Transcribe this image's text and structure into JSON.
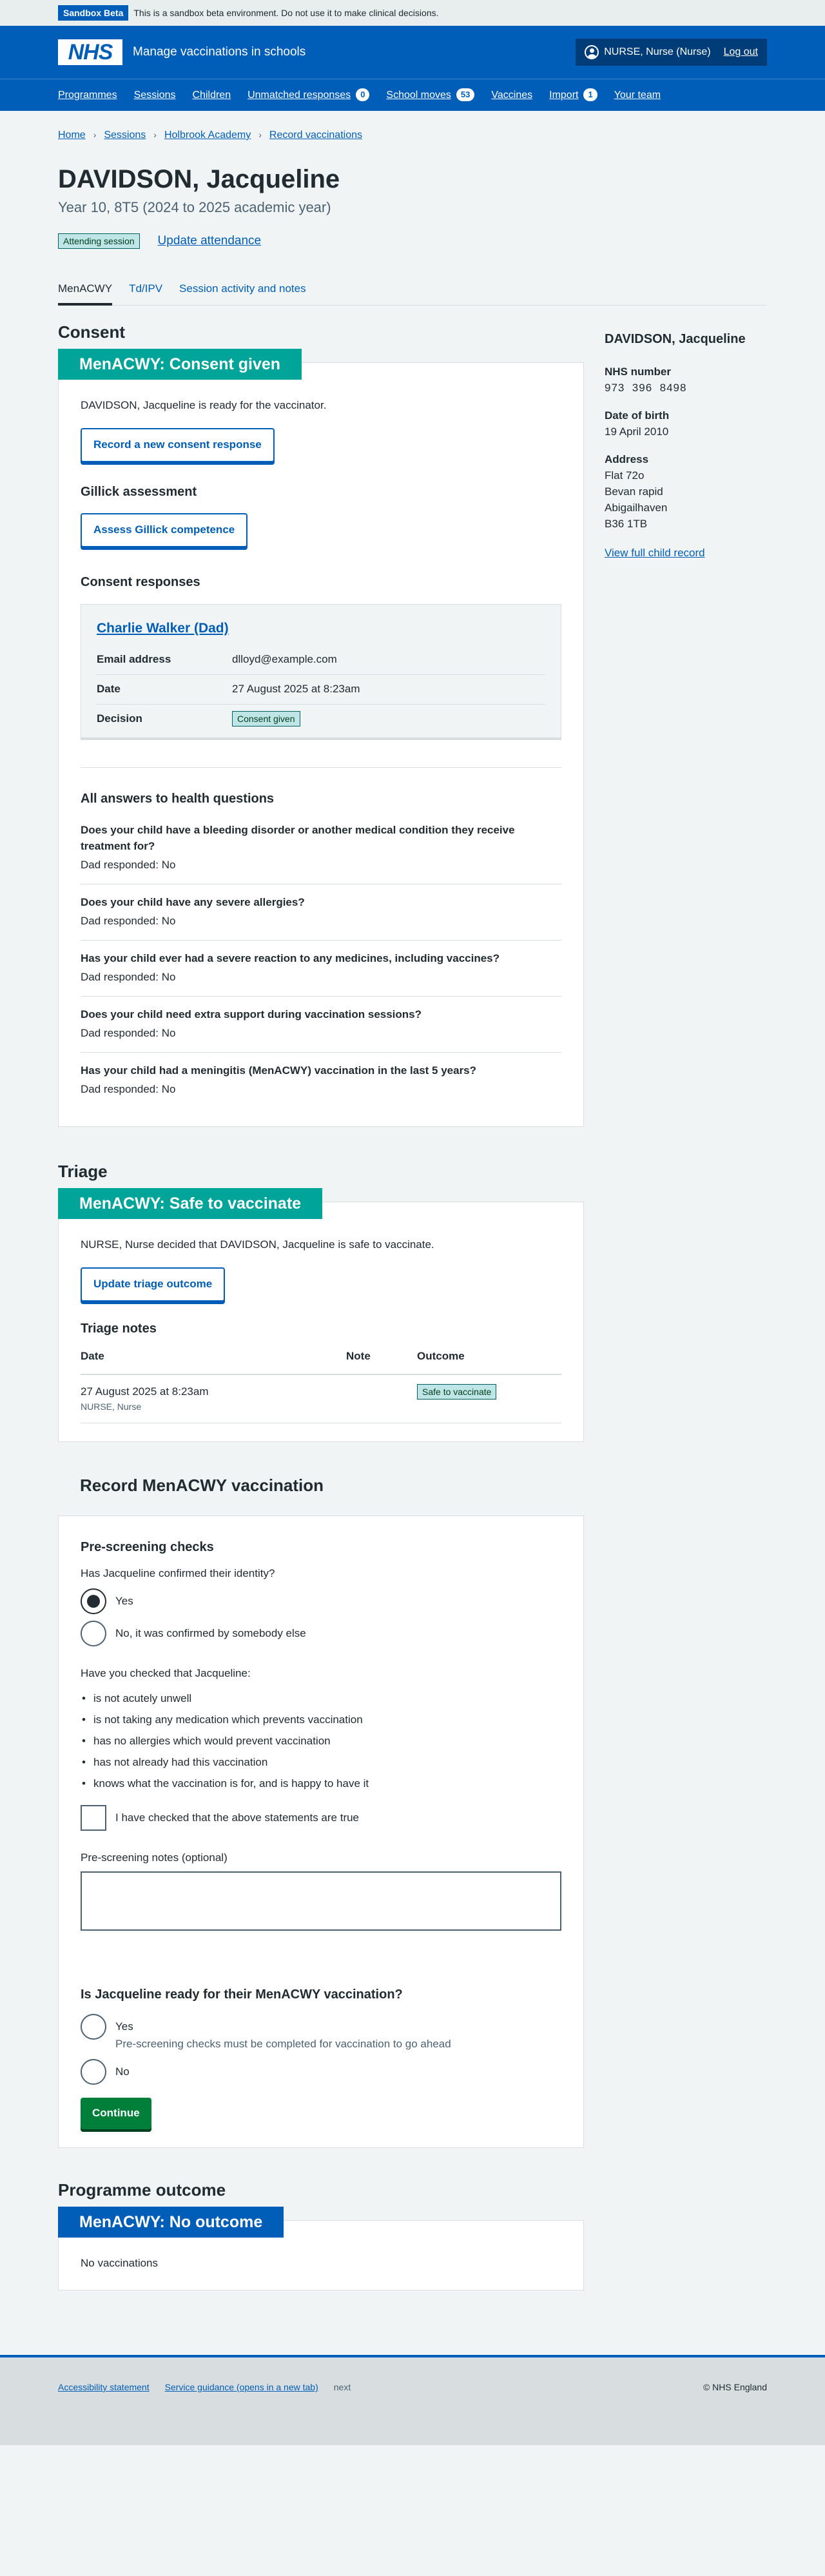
{
  "beta": {
    "tag": "Sandbox Beta",
    "text": "This is a sandbox beta environment. Do not use it to make clinical decisions."
  },
  "header": {
    "logo": "NHS",
    "service": "Manage vaccinations in schools",
    "user": "NURSE, Nurse (Nurse)",
    "logout": "Log out"
  },
  "nav": [
    {
      "label": "Programmes"
    },
    {
      "label": "Sessions"
    },
    {
      "label": "Children"
    },
    {
      "label": "Unmatched responses",
      "count": "0"
    },
    {
      "label": "School moves",
      "count": "53"
    },
    {
      "label": "Vaccines"
    },
    {
      "label": "Import",
      "count": "1"
    },
    {
      "label": "Your team"
    }
  ],
  "breadcrumb": [
    "Home",
    "Sessions",
    "Holbrook Academy",
    "Record vaccinations"
  ],
  "patient": {
    "name": "DAVIDSON, Jacqueline",
    "subtitle": "Year 10, 8T5 (2024 to 2025 academic year)",
    "attending_tag": "Attending session",
    "update_attendance": "Update attendance"
  },
  "tabs": [
    "MenACWY",
    "Td/IPV",
    "Session activity and notes"
  ],
  "consent": {
    "section_title": "Consent",
    "card_heading": "MenACWY: Consent given",
    "ready_text": "DAVIDSON, Jacqueline is ready for the vaccinator.",
    "record_button": "Record a new consent response",
    "gillick_title": "Gillick assessment",
    "gillick_button": "Assess Gillick competence",
    "responses_title": "Consent responses",
    "response": {
      "name": "Charlie Walker (Dad)",
      "rows": [
        {
          "key": "Email address",
          "value": "dlloyd@example.com"
        },
        {
          "key": "Date",
          "value": "27 August 2025 at 8:23am"
        },
        {
          "key": "Decision",
          "value": "Consent given"
        }
      ]
    },
    "health_title": "All answers to health questions",
    "health": [
      {
        "q": "Does your child have a bleeding disorder or another medical condition they receive treatment for?",
        "a": "Dad responded: No"
      },
      {
        "q": "Does your child have any severe allergies?",
        "a": "Dad responded: No"
      },
      {
        "q": "Has your child ever had a severe reaction to any medicines, including vaccines?",
        "a": "Dad responded: No"
      },
      {
        "q": "Does your child need extra support during vaccination sessions?",
        "a": "Dad responded: No"
      },
      {
        "q": "Has your child had a meningitis (MenACWY) vaccination in the last 5 years?",
        "a": "Dad responded: No"
      }
    ]
  },
  "triage": {
    "section_title": "Triage",
    "card_heading": "MenACWY: Safe to vaccinate",
    "text": "NURSE, Nurse decided that DAVIDSON, Jacqueline is safe to vaccinate.",
    "button": "Update triage outcome",
    "notes_title": "Triage notes",
    "columns": [
      "Date",
      "Note",
      "Outcome"
    ],
    "row": {
      "date": "27 August 2025 at 8:23am",
      "by": "NURSE, Nurse",
      "note": "",
      "outcome": "Safe to vaccinate"
    }
  },
  "record": {
    "title": "Record MenACWY vaccination",
    "prescreen_title": "Pre-screening checks",
    "identity_q": "Has Jacqueline confirmed their identity?",
    "identity_yes": "Yes",
    "identity_no": "No, it was confirmed by somebody else",
    "checked_intro": "Have you checked that Jacqueline:",
    "checks": [
      "is not acutely unwell",
      "is not taking any medication which prevents vaccination",
      "has no allergies which would prevent vaccination",
      "has not already had this vaccination",
      "knows what the vaccination is for, and is happy to have it"
    ],
    "checkbox_label": "I have checked that the above statements are true",
    "notes_label": "Pre-screening notes (optional)",
    "ready_q": "Is Jacqueline ready for their MenACWY vaccination?",
    "ready_yes": "Yes",
    "ready_yes_hint": "Pre-screening checks must be completed for vaccination to go ahead",
    "ready_no": "No",
    "continue": "Continue"
  },
  "outcome": {
    "section_title": "Programme outcome",
    "card_heading": "MenACWY: No outcome",
    "text": "No vaccinations"
  },
  "aside": {
    "name": "DAVIDSON, Jacqueline",
    "nhs_label": "NHS number",
    "nhs_value": "973  396  8498",
    "dob_label": "Date of birth",
    "dob_value": "19 April 2010",
    "address_label": "Address",
    "address": [
      "Flat 72o",
      "Bevan rapid",
      "Abigailhaven",
      "B36 1TB"
    ],
    "link": "View full child record"
  },
  "footer": {
    "links": [
      "Accessibility statement",
      "Service guidance (opens in a new tab)"
    ],
    "version": "next",
    "copyright": "© NHS England"
  }
}
